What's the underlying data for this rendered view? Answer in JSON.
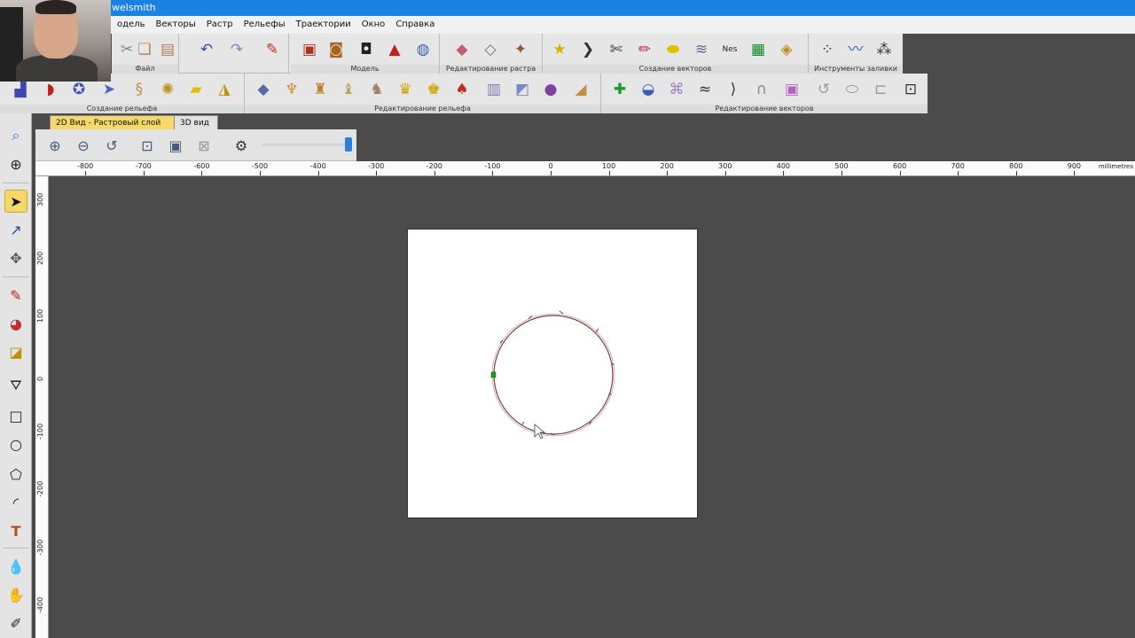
{
  "window": {
    "title_fragment": "welsmith"
  },
  "menu": [
    "одель",
    "Векторы",
    "Растр",
    "Рельефы",
    "Траектории",
    "Окно",
    "Справка"
  ],
  "toolbar1": {
    "groups": [
      {
        "label": "Файл"
      },
      {
        "label": "Модель"
      },
      {
        "label": "Редактирование растра"
      },
      {
        "label": "Создание векторов"
      },
      {
        "label": "Инструменты заливки"
      }
    ]
  },
  "toolbar2": {
    "groups": [
      {
        "label": "Создание рельефа"
      },
      {
        "label": "Редактирование рельефа"
      },
      {
        "label": "Редактирование векторов"
      }
    ]
  },
  "tabs": [
    {
      "label": "2D Вид - Растровый слой",
      "active": true,
      "close": "✕"
    },
    {
      "label": "3D вид",
      "active": false
    }
  ],
  "ruler": {
    "units": "millimetres",
    "h_labels": [
      "-800",
      "-700",
      "-600",
      "-500",
      "-400",
      "-300",
      "-200",
      "-100",
      "0",
      "100",
      "200",
      "300",
      "400",
      "500",
      "600",
      "700",
      "800",
      "900"
    ],
    "v_labels": [
      "300",
      "200",
      "100",
      "0",
      "-100",
      "-200",
      "-300",
      "-400"
    ]
  },
  "view": {
    "zoom_level": 0.97
  },
  "colors": {
    "titlebar": "#1a82e2",
    "active_tab": "#f7d96b",
    "workspace": "#4b4b4b",
    "vector_stroke": "#7a3b3b",
    "selected_node": "#1ea01e"
  }
}
